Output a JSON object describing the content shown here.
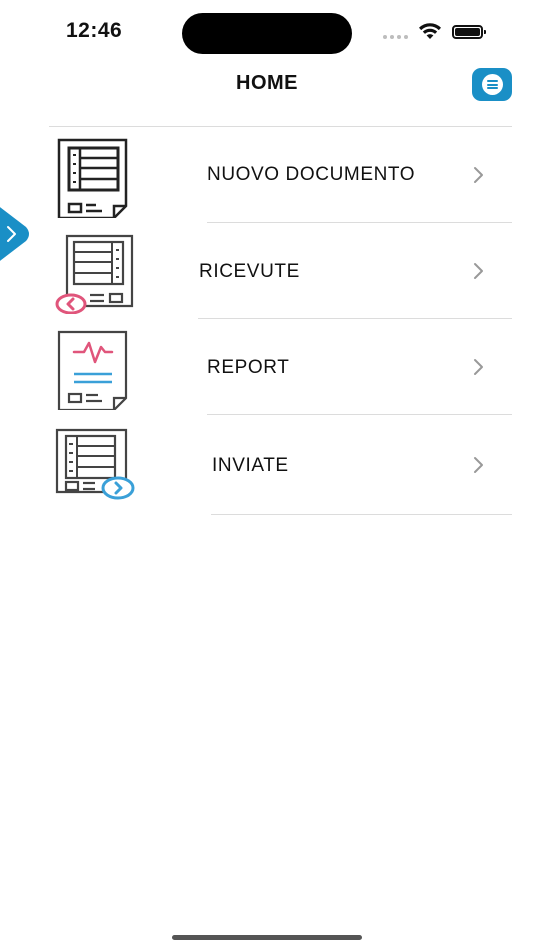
{
  "status_bar": {
    "time": "12:46"
  },
  "header": {
    "title": "HOME"
  },
  "menu": {
    "items": [
      {
        "label": "NUOVO DOCUMENTO",
        "icon": "new-document-icon"
      },
      {
        "label": "RICEVUTE",
        "icon": "received-documents-icon"
      },
      {
        "label": "REPORT",
        "icon": "report-document-icon"
      },
      {
        "label": "INVIATE",
        "icon": "sent-documents-icon"
      }
    ]
  },
  "colors": {
    "accent": "#1a8fc6",
    "received": "#e0557b",
    "sent": "#3aa0d8",
    "icon_stroke": "#333333",
    "divider": "#dcdcdc"
  }
}
